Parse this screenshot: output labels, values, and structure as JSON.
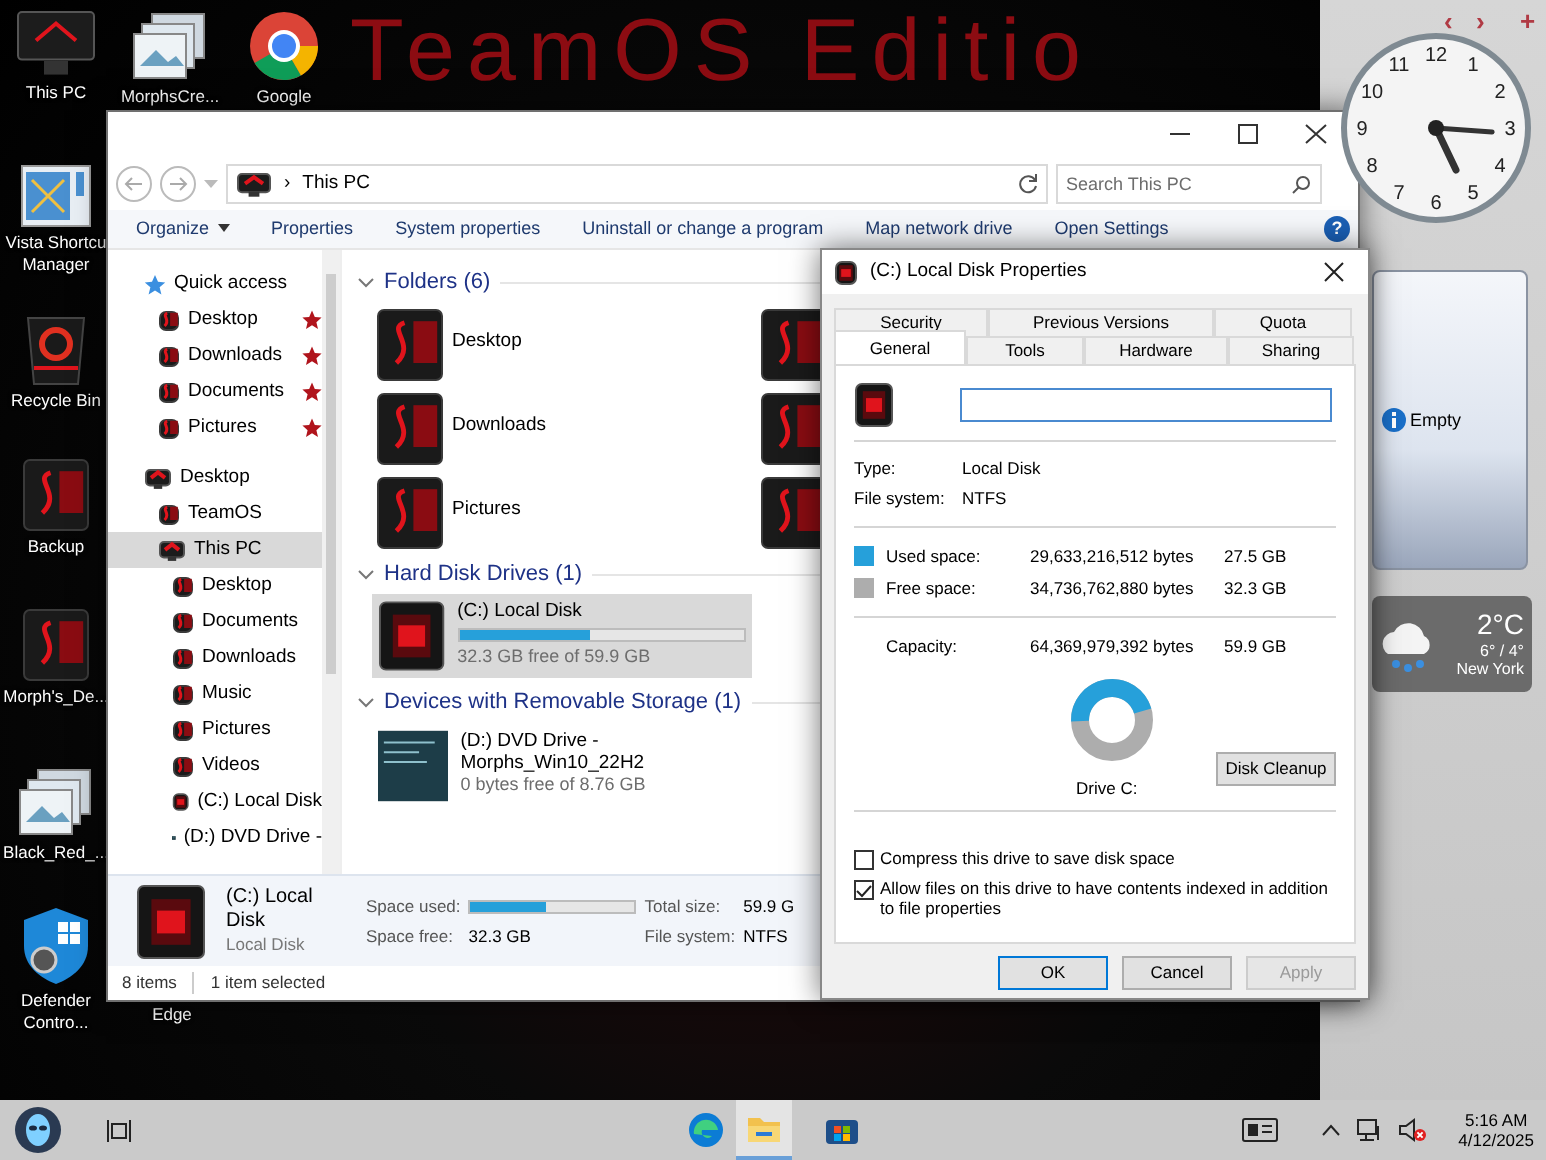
{
  "wallpaper_text": "TeamOS Editio",
  "desktop_icons": [
    {
      "label": "This PC",
      "kind": "pc"
    },
    {
      "label": "MorphsCre...",
      "kind": "images"
    },
    {
      "label": "Google",
      "kind": "chrome"
    },
    {
      "label": "Vista Shortcu Manager",
      "kind": "shortcut"
    },
    {
      "label": "Recycle Bin",
      "kind": "recycle"
    },
    {
      "label": "Backup",
      "kind": "folder"
    },
    {
      "label": "Morph's_De...",
      "kind": "folder"
    },
    {
      "label": "Black_Red_...",
      "kind": "images"
    },
    {
      "label": "Defender Contro...",
      "kind": "shield"
    },
    {
      "label": "Edge",
      "kind": "covered"
    }
  ],
  "gadget_controls": [
    "‹",
    "›",
    "+"
  ],
  "clock": {
    "numerals": [
      "12",
      "11",
      "1",
      "10",
      "2",
      "9",
      "3",
      "8",
      "4",
      "7",
      "5",
      "6"
    ]
  },
  "slideshow": {
    "text": "Empty"
  },
  "weather": {
    "temperature": "2°C",
    "range": "6° / 4°",
    "city": "New York"
  },
  "explorer": {
    "address": {
      "separator": "›",
      "location": "This PC"
    },
    "search": {
      "placeholder": "Search This PC"
    },
    "help": "?",
    "toolbar": [
      {
        "label": "Organize",
        "dropdown": true
      },
      {
        "label": "Properties",
        "dropdown": false
      },
      {
        "label": "System properties",
        "dropdown": false
      },
      {
        "label": "Uninstall or change a program",
        "dropdown": false
      },
      {
        "label": "Map network drive",
        "dropdown": false
      },
      {
        "label": "Open Settings",
        "dropdown": false
      }
    ],
    "nav": [
      {
        "label": "Quick access",
        "kind": "quick",
        "selected": false,
        "children": [
          {
            "label": "Desktop",
            "kind": "folder",
            "selected": false,
            "pinned": true
          },
          {
            "label": "Downloads",
            "kind": "folder",
            "selected": false,
            "pinned": true
          },
          {
            "label": "Documents",
            "kind": "folder",
            "selected": false,
            "pinned": true
          },
          {
            "label": "Pictures",
            "kind": "folder",
            "selected": false,
            "pinned": true
          }
        ]
      },
      {
        "label": "Desktop",
        "kind": "pc",
        "selected": false,
        "children": [
          {
            "label": "TeamOS",
            "kind": "folder",
            "selected": false
          },
          {
            "label": "This PC",
            "kind": "pc",
            "selected": true,
            "children": [
              {
                "label": "Desktop",
                "kind": "folder",
                "selected": false
              },
              {
                "label": "Documents",
                "kind": "folder",
                "selected": false
              },
              {
                "label": "Downloads",
                "kind": "folder",
                "selected": false
              },
              {
                "label": "Music",
                "kind": "folder",
                "selected": false
              },
              {
                "label": "Pictures",
                "kind": "folder",
                "selected": false
              },
              {
                "label": "Videos",
                "kind": "folder",
                "selected": false
              },
              {
                "label": "(C:) Local Disk",
                "kind": "drive",
                "selected": false
              },
              {
                "label": "(D:) DVD Drive -",
                "kind": "dvd",
                "selected": false
              }
            ]
          }
        ]
      }
    ],
    "sections": [
      {
        "title": "Folders (6)",
        "kind": "folders",
        "items": [
          {
            "kind": "named",
            "name": "Desktop"
          },
          {
            "kind": "unlabeled"
          },
          {
            "kind": "named",
            "name": "Downloads"
          },
          {
            "kind": "unlabeled"
          },
          {
            "kind": "named",
            "name": "Pictures"
          },
          {
            "kind": "unlabeled"
          }
        ]
      },
      {
        "title": "Hard Disk Drives (1)",
        "kind": "drives",
        "items": [
          {
            "name": "(C:) Local Disk",
            "kind": "hdd",
            "selected": true,
            "level": 0.46,
            "free": "32.3 GB free of 59.9 GB"
          }
        ]
      },
      {
        "title": "Devices with Removable Storage (1)",
        "kind": "drives",
        "items": [
          {
            "name": "(D:) DVD Drive - Morphs_Win10_22H2",
            "kind": "dvd",
            "selected": false,
            "free": "0 bytes free of 8.76 GB"
          }
        ]
      }
    ],
    "details": {
      "name": "(C:) Local Disk",
      "type": "Local Disk",
      "usage": {
        "label": "Space used:",
        "level": 0.46
      },
      "free_label": "Space free:",
      "free": "32.3 GB",
      "total_label": "Total size:",
      "total": "59.9 G",
      "fs_label": "File system:",
      "fs": "NTFS"
    },
    "status": [
      "8 items",
      "1 item selected"
    ]
  },
  "dialog": {
    "title": "(C:) Local Disk Properties",
    "tab_rows": [
      {
        "tabs": [
          {
            "label": "Security",
            "selected": false
          },
          {
            "label": "Previous Versions",
            "selected": false
          },
          {
            "label": "Quota",
            "selected": false
          }
        ]
      },
      {
        "tabs": [
          {
            "label": "General",
            "selected": true
          },
          {
            "label": "Tools",
            "selected": false
          },
          {
            "label": "Hardware",
            "selected": false
          },
          {
            "label": "Sharing",
            "selected": false
          }
        ]
      }
    ],
    "type_label": "Type:",
    "type": "Local Disk",
    "fs_label": "File system:",
    "fs": "NTFS",
    "space": [
      {
        "label": "Used space:",
        "bytes": "29,633,216,512 bytes",
        "size": "27.5 GB",
        "color": "#26a0da"
      },
      {
        "label": "Free space:",
        "bytes": "34,736,762,880 bytes",
        "size": "32.3 GB",
        "color": "#adadad"
      }
    ],
    "capacity": {
      "label": "Capacity:",
      "bytes": "64,369,979,392 bytes",
      "size": "59.9 GB"
    },
    "drive_label": "Drive C:",
    "cleanup": "Disk Cleanup",
    "options": [
      {
        "label": "Compress this drive to save disk space",
        "checked": false
      },
      {
        "label": "Allow files on this drive to have contents indexed in addition to file properties",
        "checked": true
      }
    ],
    "buttons": [
      {
        "label": "OK",
        "kind": "default",
        "disabled": false
      },
      {
        "label": "Cancel",
        "kind": "normal",
        "disabled": false
      },
      {
        "label": "Apply",
        "kind": "normal",
        "disabled": true
      }
    ]
  },
  "taskbar": {
    "apps": [
      {
        "kind": "edge",
        "active": false
      },
      {
        "kind": "explorer",
        "active": true
      },
      {
        "kind": "store",
        "active": false
      }
    ],
    "muted": true,
    "time": "5:16 AM",
    "date": "4/12/2025"
  }
}
